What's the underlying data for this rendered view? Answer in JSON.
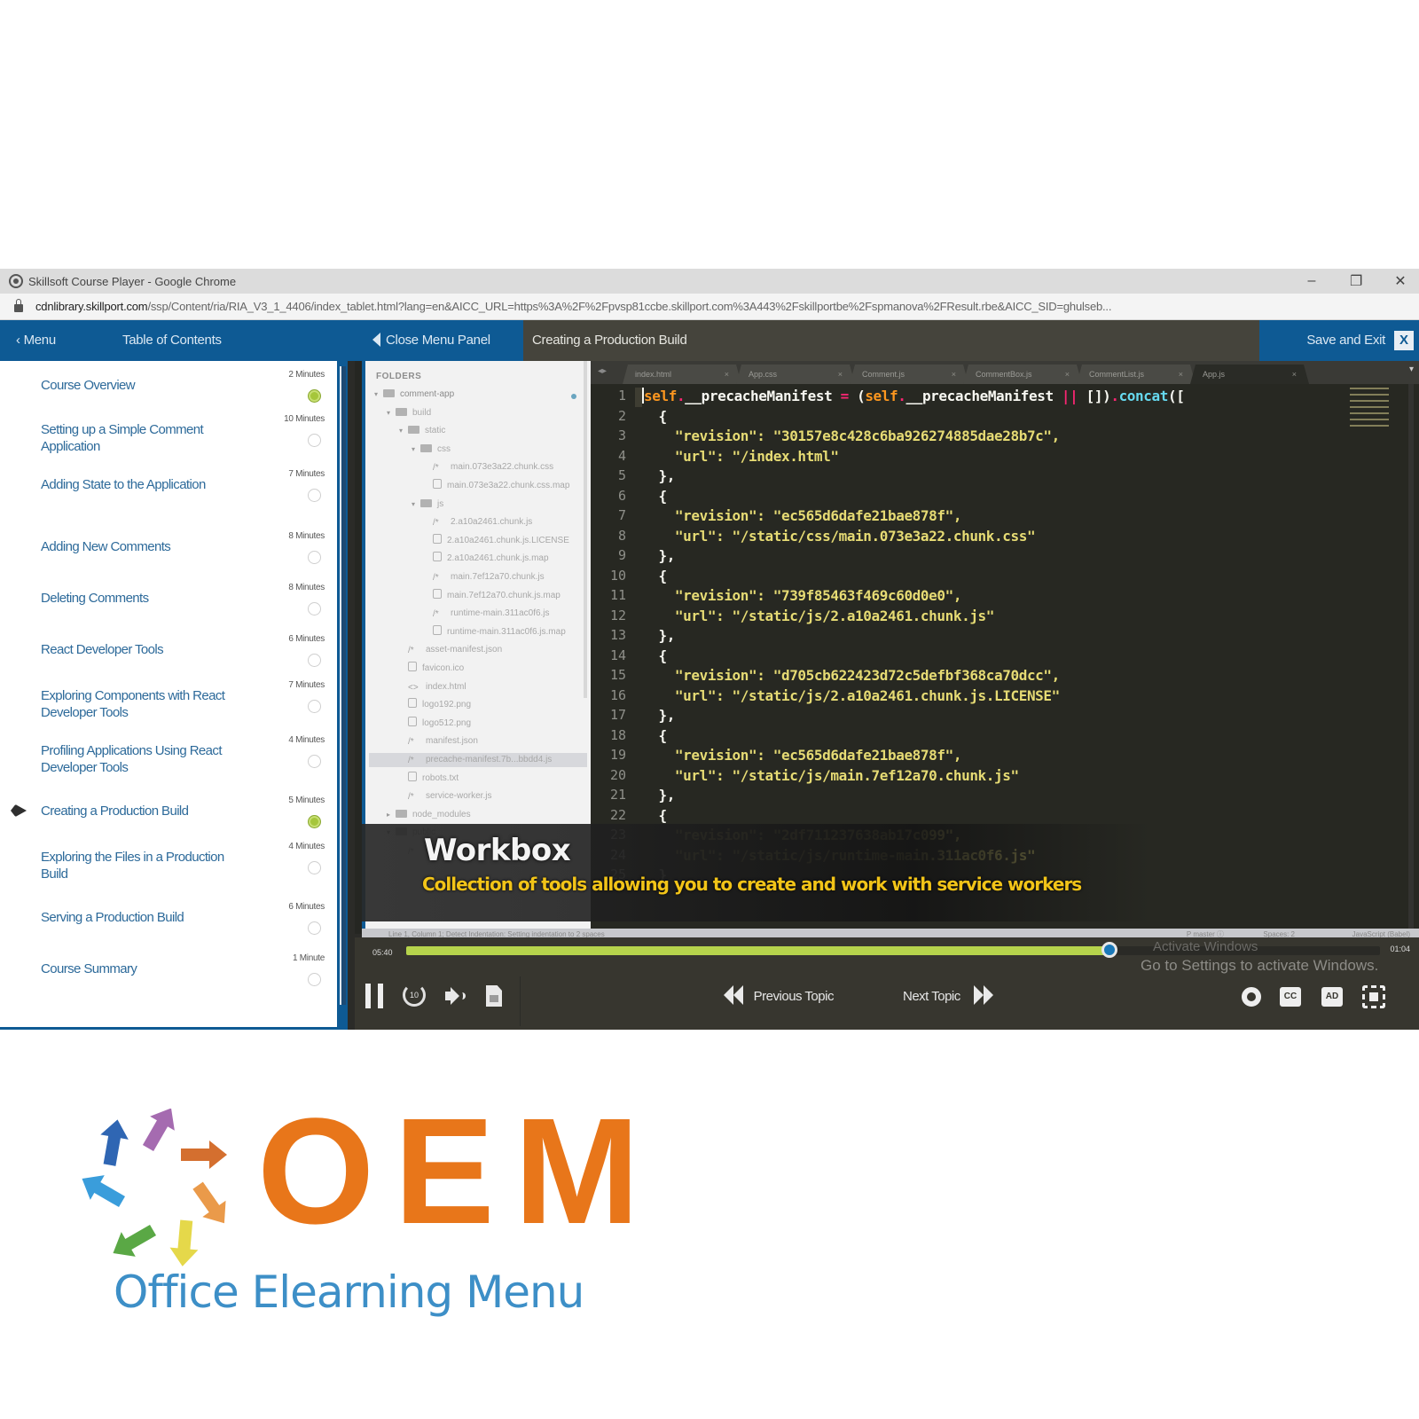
{
  "browser": {
    "window_title": "Skillsoft Course Player - Google Chrome",
    "url_host": "cdnlibrary.skillport.com",
    "url_path": "/ssp/Content/ria/RIA_V3_1_4406/index_tablet.html?lang=en&AICC_URL=https%3A%2F%2Fpvsp81ccbe.skillport.com%3A443%2Fskillportbe%2Fspmanova%2FResult.rbe&AICC_SID=ghulseb...",
    "controls": {
      "minimize": "–",
      "restore": "❐",
      "close": "✕"
    }
  },
  "navbar": {
    "menu_label": "‹ Menu",
    "toc_label": "Table of Contents",
    "close_panel_label": "Close Menu Panel",
    "lesson_title": "Creating a Production Build",
    "save_exit_label": "Save and Exit",
    "close_icon": "X"
  },
  "toc": {
    "items": [
      {
        "title": "Course Overview",
        "duration": "2 Minutes",
        "status": "completed",
        "current": false
      },
      {
        "title": "Setting up a Simple Comment Application",
        "duration": "10 Minutes",
        "status": "not-started",
        "current": false
      },
      {
        "title": "Adding State to the Application",
        "duration": "7 Minutes",
        "status": "not-started",
        "current": false
      },
      {
        "title": "Adding New Comments",
        "duration": "8 Minutes",
        "status": "not-started",
        "current": false
      },
      {
        "title": "Deleting Comments",
        "duration": "8 Minutes",
        "status": "not-started",
        "current": false
      },
      {
        "title": "React Developer Tools",
        "duration": "6 Minutes",
        "status": "not-started",
        "current": false
      },
      {
        "title": "Exploring Components with React Developer Tools",
        "duration": "7 Minutes",
        "status": "not-started",
        "current": false
      },
      {
        "title": "Profiling Applications Using React Developer Tools",
        "duration": "4 Minutes",
        "status": "not-started",
        "current": false
      },
      {
        "title": "Creating a Production Build",
        "duration": "5 Minutes",
        "status": "completed",
        "current": true
      },
      {
        "title": "Exploring the Files in a Production Build",
        "duration": "4 Minutes",
        "status": "not-started",
        "current": false
      },
      {
        "title": "Serving a Production Build",
        "duration": "6 Minutes",
        "status": "not-started",
        "current": false
      },
      {
        "title": "Course Summary",
        "duration": "1 Minute",
        "status": "not-started",
        "current": false
      }
    ]
  },
  "folders": {
    "header": "FOLDERS",
    "tree": [
      {
        "name": "comment-app",
        "type": "folder",
        "depth": 0,
        "expanded": true
      },
      {
        "name": "build",
        "type": "folder",
        "depth": 1,
        "expanded": true
      },
      {
        "name": "static",
        "type": "folder",
        "depth": 2,
        "expanded": true
      },
      {
        "name": "css",
        "type": "folder",
        "depth": 3,
        "expanded": true
      },
      {
        "name": "main.073e3a22.chunk.css",
        "type": "code",
        "depth": 4
      },
      {
        "name": "main.073e3a22.chunk.css.map",
        "type": "file",
        "depth": 4
      },
      {
        "name": "js",
        "type": "folder",
        "depth": 3,
        "expanded": true
      },
      {
        "name": "2.a10a2461.chunk.js",
        "type": "code",
        "depth": 4
      },
      {
        "name": "2.a10a2461.chunk.js.LICENSE",
        "type": "file",
        "depth": 4
      },
      {
        "name": "2.a10a2461.chunk.js.map",
        "type": "file",
        "depth": 4
      },
      {
        "name": "main.7ef12a70.chunk.js",
        "type": "code",
        "depth": 4
      },
      {
        "name": "main.7ef12a70.chunk.js.map",
        "type": "file",
        "depth": 4
      },
      {
        "name": "runtime-main.311ac0f6.js",
        "type": "code",
        "depth": 4
      },
      {
        "name": "runtime-main.311ac0f6.js.map",
        "type": "file",
        "depth": 4
      },
      {
        "name": "asset-manifest.json",
        "type": "code",
        "depth": 2
      },
      {
        "name": "favicon.ico",
        "type": "image",
        "depth": 2
      },
      {
        "name": "index.html",
        "type": "markup",
        "depth": 2
      },
      {
        "name": "logo192.png",
        "type": "image",
        "depth": 2
      },
      {
        "name": "logo512.png",
        "type": "image",
        "depth": 2
      },
      {
        "name": "manifest.json",
        "type": "code",
        "depth": 2
      },
      {
        "name": "precache-manifest.7b...bbdd4.js",
        "type": "code",
        "depth": 2,
        "selected": true
      },
      {
        "name": "robots.txt",
        "type": "text",
        "depth": 2
      },
      {
        "name": "service-worker.js",
        "type": "code",
        "depth": 2
      },
      {
        "name": "node_modules",
        "type": "folder",
        "depth": 1,
        "expanded": false
      },
      {
        "name": "public",
        "type": "folder",
        "depth": 1,
        "expanded": true
      },
      {
        "name": "manifest.json",
        "type": "code",
        "depth": 2
      }
    ]
  },
  "editor": {
    "tabs": [
      {
        "label": "index.html",
        "active": false
      },
      {
        "label": "App.css",
        "active": false
      },
      {
        "label": "Comment.js",
        "active": false
      },
      {
        "label": "CommentBox.js",
        "active": false
      },
      {
        "label": "CommentList.js",
        "active": false
      },
      {
        "label": "App.js",
        "active": true
      }
    ],
    "tab_close": "×",
    "lines": [
      "self.__precacheManifest = (self.__precacheManifest || []).concat([",
      "  {",
      "    \"revision\": \"30157e8c428c6ba926274885dae28b7c\",",
      "    \"url\": \"/index.html\"",
      "  },",
      "  {",
      "    \"revision\": \"ec565d6dafe21bae878f\",",
      "    \"url\": \"/static/css/main.073e3a22.chunk.css\"",
      "  },",
      "  {",
      "    \"revision\": \"739f85463f469c60d0e0\",",
      "    \"url\": \"/static/js/2.a10a2461.chunk.js\"",
      "  },",
      "  {",
      "    \"revision\": \"d705cb622423d72c5defbf368ca70dcc\",",
      "    \"url\": \"/static/js/2.a10a2461.chunk.js.LICENSE\"",
      "  },",
      "  {",
      "    \"revision\": \"ec565d6dafe21bae878f\",",
      "    \"url\": \"/static/js/main.7ef12a70.chunk.js\"",
      "  },",
      "  {",
      "    \"revision\": \"2df711237638ab17c099\",",
      "    \"url\": \"/static/js/runtime-main.311ac0f6.js\"",
      "  }"
    ],
    "line1": {
      "self1": "self",
      "dot1": ".",
      "prop1": "__precacheManifest",
      "eq": " = ",
      "paren": "(",
      "self2": "self",
      "dot2": ".",
      "prop2": "__precacheManifest",
      "or": " || ",
      "arr": "[])",
      "dot3": ".",
      "concat": "concat",
      "tail": "(["
    },
    "status_left": "Line 1, Column 1; Detect Indentation: Setting indentation to 2 spaces",
    "status_right": [
      "P master ⓘ",
      "Spaces: 2",
      "JavaScript (Babel)"
    ]
  },
  "caption": {
    "title": "Workbox",
    "subtitle": "Collection of tools allowing you to create and work with service workers"
  },
  "player": {
    "elapsed": "05:40",
    "remaining": "01:04",
    "progress_fraction": 0.722,
    "prev_label": "Previous Topic",
    "next_label": "Next Topic",
    "replay_label": "10",
    "cc_label": "CC",
    "ad_label": "AD",
    "watermark_title": "Activate Windows",
    "watermark_text": "Go to Settings to activate Windows."
  },
  "logo": {
    "wordmark": "OEM",
    "tagline": "Office Elearning Menu",
    "colors": {
      "wordmark": "#e8761a",
      "tagline": "#3d8fc7",
      "arrows": [
        "#2f66b3",
        "#a56bb0",
        "#d46f2f",
        "#ea9a4a",
        "#e5d84a",
        "#5aa845",
        "#3a9ddb"
      ]
    }
  },
  "colors": {
    "navbar_blue": "#0e5a94",
    "progress_green": "#b6d44c",
    "caption_yellow": "#f2c418",
    "status_done": "#a5c63b"
  }
}
